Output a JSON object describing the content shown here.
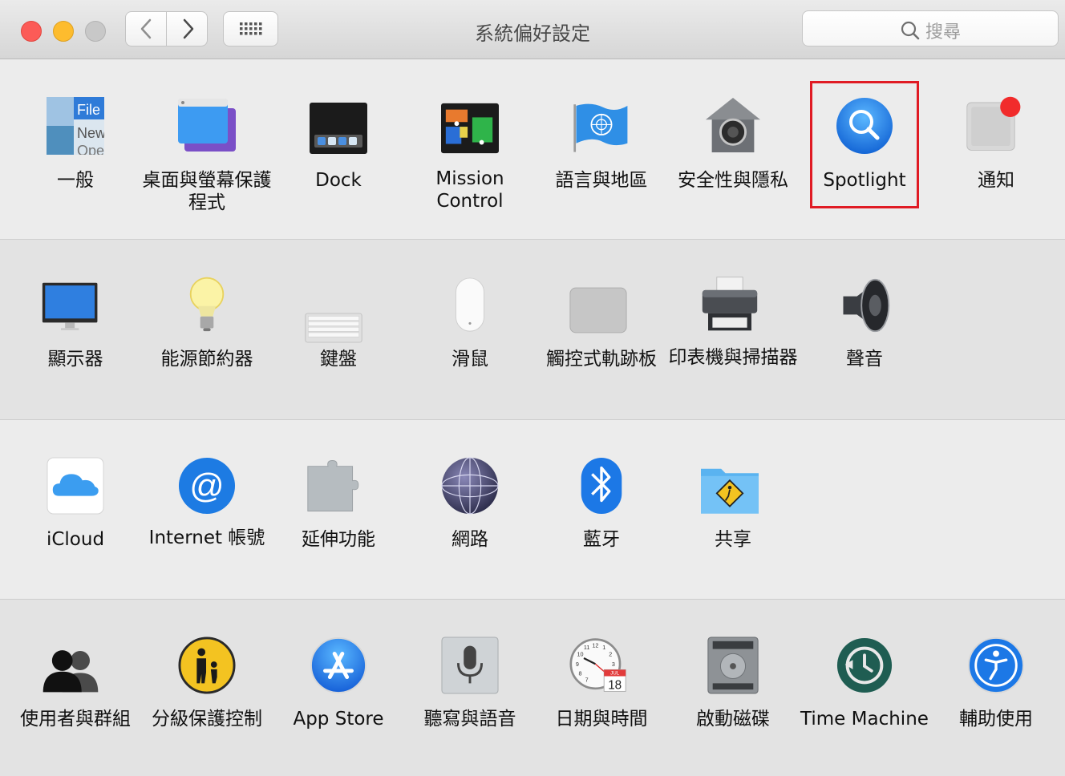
{
  "window": {
    "title": "系統偏好設定",
    "search_placeholder": "搜尋"
  },
  "colors": {
    "highlight": "#e01b24",
    "close": "#fc5b57",
    "minimize": "#fdbc2e",
    "zoom": "#c8c8c8"
  },
  "toolbar": {
    "back_icon": "chevron-left-icon",
    "forward_icon": "chevron-right-icon",
    "grid_icon": "grid-icon",
    "search_icon": "search-icon"
  },
  "rows": [
    [
      {
        "label": "一般",
        "icon": "general-icon"
      },
      {
        "label": "桌面與螢幕保護程式",
        "icon": "desktop-screensaver-icon"
      },
      {
        "label": "Dock",
        "icon": "dock-icon"
      },
      {
        "label": "Mission Control",
        "icon": "mission-control-icon"
      },
      {
        "label": "語言與地區",
        "icon": "language-region-icon"
      },
      {
        "label": "安全性與隱私",
        "icon": "security-privacy-icon"
      },
      {
        "label": "Spotlight",
        "icon": "spotlight-icon"
      },
      {
        "label": "通知",
        "icon": "notifications-icon"
      }
    ],
    [
      {
        "label": "顯示器",
        "icon": "displays-icon"
      },
      {
        "label": "能源節約器",
        "icon": "energy-saver-icon"
      },
      {
        "label": "鍵盤",
        "icon": "keyboard-icon"
      },
      {
        "label": "滑鼠",
        "icon": "mouse-icon"
      },
      {
        "label": "觸控式軌跡板",
        "icon": "trackpad-icon"
      },
      {
        "label": "印表機與掃描器",
        "icon": "printers-scanners-icon"
      },
      {
        "label": "聲音",
        "icon": "sound-icon"
      }
    ],
    [
      {
        "label": "iCloud",
        "icon": "icloud-icon"
      },
      {
        "label": "Internet 帳號",
        "icon": "internet-accounts-icon"
      },
      {
        "label": "延伸功能",
        "icon": "extensions-icon"
      },
      {
        "label": "網路",
        "icon": "network-icon"
      },
      {
        "label": "藍牙",
        "icon": "bluetooth-icon"
      },
      {
        "label": "共享",
        "icon": "sharing-icon"
      }
    ],
    [
      {
        "label": "使用者與群組",
        "icon": "users-groups-icon"
      },
      {
        "label": "分級保護控制",
        "icon": "parental-controls-icon"
      },
      {
        "label": "App Store",
        "icon": "app-store-icon"
      },
      {
        "label": "聽寫與語音",
        "icon": "dictation-speech-icon"
      },
      {
        "label": "日期與時間",
        "icon": "date-time-icon"
      },
      {
        "label": "啟動磁碟",
        "icon": "startup-disk-icon"
      },
      {
        "label": "Time Machine",
        "icon": "time-machine-icon"
      },
      {
        "label": "輔助使用",
        "icon": "accessibility-icon"
      }
    ]
  ],
  "icon_text": {
    "general_file": "File",
    "general_new": "New",
    "general_open": "Ope",
    "calendar_month": "JUL",
    "calendar_day": "18",
    "clock_12": "12",
    "clock_11": "11",
    "clock_10": "10",
    "clock_9": "9",
    "clock_8": "8",
    "clock_7": "7",
    "clock_1": "1",
    "clock_2": "2",
    "clock_3": "3"
  }
}
